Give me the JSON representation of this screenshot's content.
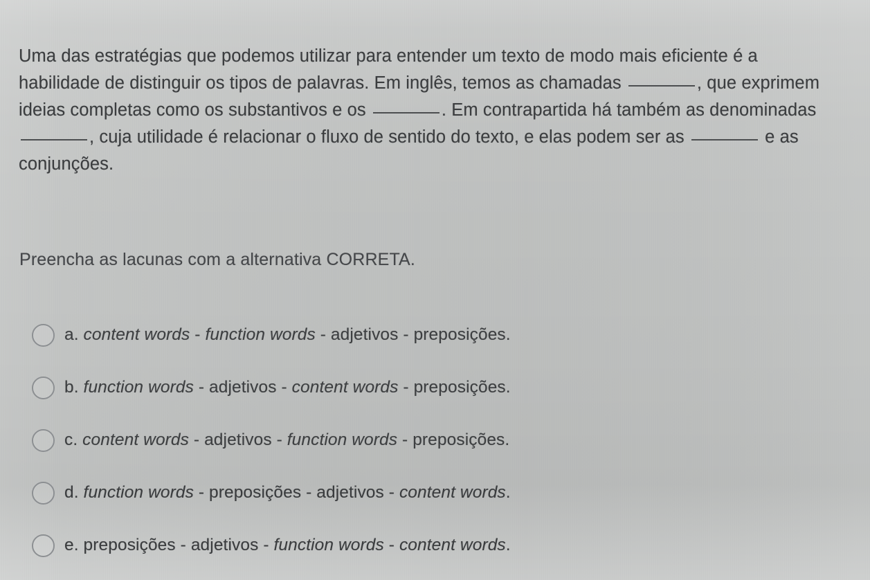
{
  "question": {
    "stem_parts": [
      {
        "type": "text",
        "value": "Uma das estratégias que podemos utilizar para entender um texto de modo mais eficiente é a habilidade de distinguir os tipos de palavras. Em inglês, temos as chamadas "
      },
      {
        "type": "blank"
      },
      {
        "type": "text",
        "value": ", que exprimem ideias completas como os substantivos e os "
      },
      {
        "type": "blank"
      },
      {
        "type": "text",
        "value": ". Em contrapartida há também as denominadas "
      },
      {
        "type": "blank"
      },
      {
        "type": "text",
        "value": ", cuja utilidade é relacionar o fluxo de sentido do texto, e elas podem ser as "
      },
      {
        "type": "blank"
      },
      {
        "type": "text",
        "value": " e as conjunções."
      }
    ],
    "stem_text": "Uma das estratégias que podemos utilizar para entender um texto de modo mais eficiente é a habilidade de distinguir os tipos de palavras. Em inglês, temos as chamadas ________, que exprimem ideias completas como os substantivos e os ________. Em contrapartida há também as denominadas ________, cuja utilidade é relacionar o fluxo de sentido do texto, e elas podem ser as ________ e as conjunções.",
    "instruction": "Preencha as lacunas com a alternativa CORRETA.",
    "options": [
      {
        "letter": "a.",
        "selected": false,
        "segments": [
          {
            "text": "content words",
            "italic": true
          },
          {
            "text": " - ",
            "italic": false
          },
          {
            "text": "function words",
            "italic": true
          },
          {
            "text": " - adjetivos - preposições.",
            "italic": false
          }
        ],
        "full_text": "content words - function words - adjetivos - preposições."
      },
      {
        "letter": "b.",
        "selected": false,
        "segments": [
          {
            "text": "function words",
            "italic": true
          },
          {
            "text": " - adjetivos - ",
            "italic": false
          },
          {
            "text": "content words",
            "italic": true
          },
          {
            "text": " - preposições.",
            "italic": false
          }
        ],
        "full_text": "function words - adjetivos - content words - preposições."
      },
      {
        "letter": "c.",
        "selected": false,
        "segments": [
          {
            "text": "content words",
            "italic": true
          },
          {
            "text": " - adjetivos - ",
            "italic": false
          },
          {
            "text": "function words",
            "italic": true
          },
          {
            "text": " - preposições.",
            "italic": false
          }
        ],
        "full_text": "content words - adjetivos - function words - preposições."
      },
      {
        "letter": "d.",
        "selected": false,
        "segments": [
          {
            "text": "function words",
            "italic": true
          },
          {
            "text": " - preposições - adjetivos - ",
            "italic": false
          },
          {
            "text": "content words",
            "italic": true
          },
          {
            "text": ".",
            "italic": false
          }
        ],
        "full_text": "function words - preposições - adjetivos - content words."
      },
      {
        "letter": "e.",
        "selected": false,
        "segments": [
          {
            "text": "preposições - adjetivos - ",
            "italic": false
          },
          {
            "text": "function words",
            "italic": true
          },
          {
            "text": " - ",
            "italic": false
          },
          {
            "text": "content words",
            "italic": true
          },
          {
            "text": ".",
            "italic": false
          }
        ],
        "full_text": "preposições - adjetivos - function words - content words."
      }
    ]
  },
  "colors": {
    "background": "#c1c3c2",
    "text": "#3b3d3f",
    "instruction_text": "#45474a",
    "radio_border": "#8c8f92"
  }
}
